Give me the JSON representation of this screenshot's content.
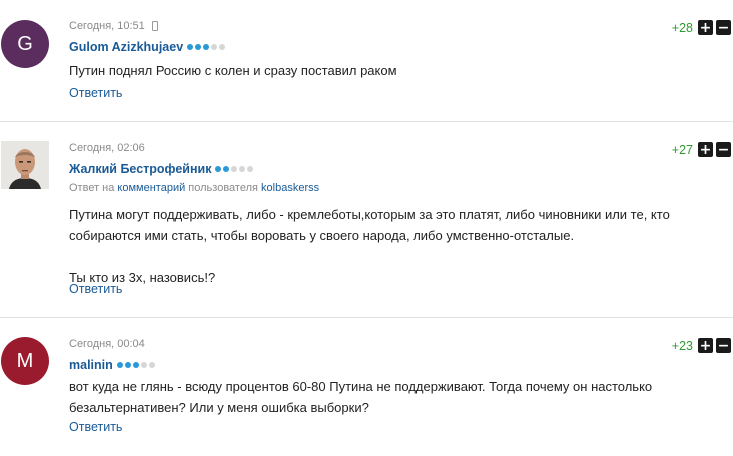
{
  "colors": {
    "accent_link": "#1a5a96",
    "score_green": "#2e9a2e",
    "dot_active": "#2a9ad6",
    "dot_inactive": "#d6d6d6"
  },
  "comments": [
    {
      "time": "Сегодня, 10:51",
      "has_device_icon": true,
      "avatar_letter": "G",
      "avatar_color": "#5a2d5e",
      "author": "Gulom Azizkhujaev",
      "rating_dots": 3,
      "reply_prefix": "",
      "reply_link": "",
      "reply_middle": "",
      "reply_user": "",
      "text": "Путин поднял Россию с колен и сразу поставил раком",
      "answer_label": "Ответить",
      "score": "+28",
      "upvote_label": "+",
      "downvote_label": "−"
    },
    {
      "time": "Сегодня, 02:06",
      "has_device_icon": false,
      "avatar_letter": "",
      "avatar_color": "",
      "author": "Жалкий Бестрофейник",
      "rating_dots": 2,
      "reply_prefix": "Ответ на",
      "reply_link": "комментарий",
      "reply_middle": "пользователя",
      "reply_user": "kolbaskerss",
      "text": "Путина могут поддерживать, либо - кремлеботы,которым за это платят, либо чиновники или те, кто\nсобираются ими стать, чтобы воровать у своего народа, либо умственно-отсталые.\n\nТы кто из 3х, назовись!?",
      "answer_label": "Ответить",
      "score": "+27",
      "upvote_label": "+",
      "downvote_label": "−"
    },
    {
      "time": "Сегодня, 00:04",
      "has_device_icon": false,
      "avatar_letter": "M",
      "avatar_color": "#9b1b2e",
      "author": "malinin",
      "rating_dots": 3,
      "reply_prefix": "",
      "reply_link": "",
      "reply_middle": "",
      "reply_user": "",
      "text": "вот куда не глянь - всюду процентов 60-80 Путина не поддерживают. Тогда почему он настолько\nбезальтернативен? Или у меня ошибка выборки?",
      "answer_label": "Ответить",
      "score": "+23",
      "upvote_label": "+",
      "downvote_label": "−"
    }
  ]
}
